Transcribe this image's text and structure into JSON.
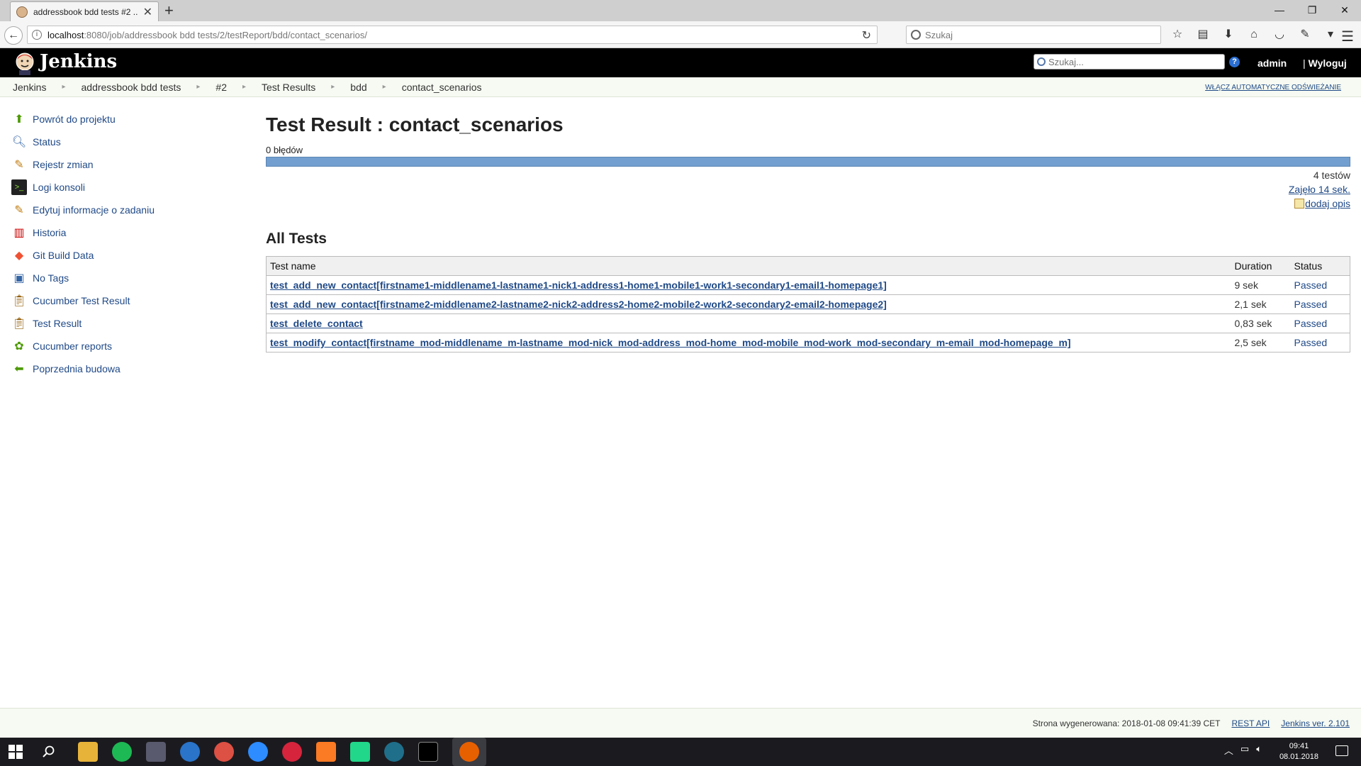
{
  "browser": {
    "tab_title": "addressbook bdd tests #2 ...",
    "url_host": "localhost",
    "url_rest": ":8080/job/addressbook bdd tests/2/testReport/bdd/contact_scenarios/",
    "search_placeholder": "Szukaj"
  },
  "header": {
    "title": "Jenkins",
    "search_placeholder": "Szukaj...",
    "user": "admin",
    "logout": "Wyloguj"
  },
  "breadcrumbs": [
    "Jenkins",
    "addressbook bdd tests",
    "#2",
    "Test Results",
    "bdd",
    "contact_scenarios"
  ],
  "autorefresh": "WŁĄCZ AUTOMATYCZNE ODŚWIEŻANIE",
  "sidebar": {
    "items": [
      {
        "label": "Powrót do projektu",
        "icon": "up-arrow-icon"
      },
      {
        "label": "Status",
        "icon": "magnifier-icon"
      },
      {
        "label": "Rejestr zmian",
        "icon": "notepad-icon"
      },
      {
        "label": "Logi konsoli",
        "icon": "terminal-icon"
      },
      {
        "label": "Edytuj informacje o zadaniu",
        "icon": "notepad-icon"
      },
      {
        "label": "Historia",
        "icon": "history-icon"
      },
      {
        "label": "Git Build Data",
        "icon": "git-icon"
      },
      {
        "label": "No Tags",
        "icon": "save-icon"
      },
      {
        "label": "Cucumber Test Result",
        "icon": "clipboard-icon"
      },
      {
        "label": "Test Result",
        "icon": "clipboard-icon"
      },
      {
        "label": "Cucumber reports",
        "icon": "cucumber-icon"
      },
      {
        "label": "Poprzednia budowa",
        "icon": "left-arrow-icon"
      }
    ]
  },
  "main": {
    "title": "Test Result : contact_scenarios",
    "failures": "0 błędów",
    "progress_passed_fraction": 1.0,
    "tests_count": "4 testów",
    "took": "Zajęło 14 sek.",
    "add_description": "dodaj opis",
    "all_tests_title": "All Tests",
    "table": {
      "headers": [
        "Test name",
        "Duration",
        "Status"
      ],
      "rows": [
        {
          "name": "test_add_new_contact[firstname1-middlename1-lastname1-nick1-address1-home1-mobile1-work1-secondary1-email1-homepage1]",
          "duration": "9 sek",
          "status": "Passed"
        },
        {
          "name": "test_add_new_contact[firstname2-middlename2-lastname2-nick2-address2-home2-mobile2-work2-secondary2-email2-homepage2]",
          "duration": "2,1 sek",
          "status": "Passed"
        },
        {
          "name": "test_delete_contact",
          "duration": "0,83 sek",
          "status": "Passed"
        },
        {
          "name": "test_modify_contact[firstname_mod-middlename_m-lastname_mod-nick_mod-address_mod-home_mod-mobile_mod-work_mod-secondary_m-email_mod-homepage_m]",
          "duration": "2,5 sek",
          "status": "Passed"
        }
      ]
    }
  },
  "footer": {
    "generated": "Strona wygenerowana: 2018-01-08 09:41:39 CET",
    "rest_api": "REST API",
    "version": "Jenkins ver. 2.101"
  },
  "taskbar": {
    "time": "09:41",
    "date": "08.01.2018"
  },
  "colors": {
    "progress_pass": "#729fcf",
    "link": "#204a87",
    "header_bg": "#000000"
  }
}
